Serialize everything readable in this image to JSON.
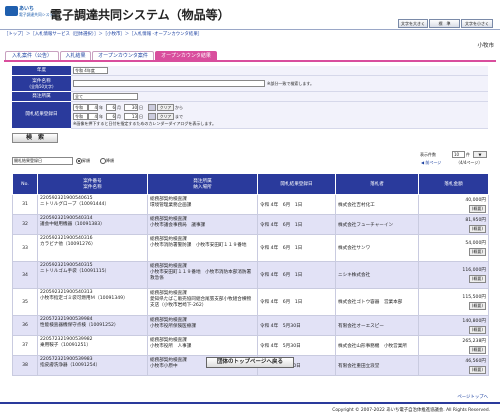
{
  "header": {
    "logo_top": "あいち",
    "logo_bottom": "電子調達共同システム",
    "title": "電子調達共同システム（物品等）",
    "btn_large": "文字を大きく",
    "btn_std": "標　準",
    "btn_small": "文字を小さく"
  },
  "breadcrumb": "［トップ］＞［入札情報サービス（団体選択）］＞［小牧市］＞［入札情報 -オープンカウンタ結果］",
  "org_name": "小牧市",
  "tabs": [
    "入札案件（公告）",
    "入札結果",
    "オープンカウンタ案件",
    "オープンカウンタ結果"
  ],
  "form": {
    "year_label": "年度",
    "year_value": "令和 4年度",
    "name_label": "案件名称",
    "name_sub": "(全角50文字)",
    "name_note": "※部分一致で検索します。",
    "dept_label": "発注所属",
    "dept_value": "全て",
    "date_label": "開札結果登録日",
    "era": "令和",
    "from_y": "4",
    "from_m": "6",
    "from_d": "30",
    "to_y": "4",
    "to_m": "6",
    "to_d": "13",
    "y_unit": "年",
    "m_unit": "月",
    "d_unit": "日",
    "clear": "クリア",
    "from_word": "から",
    "to_word": "まで",
    "cal_note": "※画像を押下すると日付を指定するためのカレンダーダイアログを表示します。"
  },
  "search_btn": "検　索",
  "sort": {
    "select_value": "開札結果登録日",
    "asc": "昇順",
    "desc": "降順"
  },
  "paging": {
    "per_page_label": "表示件数",
    "per_page_value": "10",
    "per_page_unit": "件",
    "prev": "前ページ",
    "page_info": "（4/4ページ）"
  },
  "table": {
    "headers": {
      "no": "No.",
      "case": "案件番号\n案件名称",
      "dept": "発注所属\n納入場所",
      "date": "開札結果登録日",
      "winner": "落札者",
      "amount": "落札金額"
    },
    "gaiyo_label": "(概要)",
    "rows": [
      {
        "no": "31",
        "case_no": "22059232190054061​5",
        "case_name": "ニトリルグローブ（10091444）",
        "dept": "総務部契約検査課",
        "place": "環境管理業務企画課",
        "date": "令和 4年　6月　1日",
        "winner": "株式会社吉村化工",
        "amount": "40,000円"
      },
      {
        "no": "32",
        "case_no": "2205923219005403​14",
        "case_name": "議会中継用機器（10091383）",
        "dept": "総務部契約検査課",
        "place": "小牧市議会事務局　議事課",
        "date": "令和 4年　6月　1日",
        "winner": "株式会社フューチャーイン",
        "amount": "81,950円"
      },
      {
        "no": "33",
        "case_no": "22059232190054031​6",
        "case_name": "カラビナ他（10091276）",
        "dept": "総務部契約検査課",
        "place": "小牧市消防署警防課　小牧市安田町１１９番地",
        "date": "令和 4年　6月　1日",
        "winner": "株式会社サンワ",
        "amount": "54,000円"
      },
      {
        "no": "34",
        "case_no": "22059232190054031​5",
        "case_name": "ニトリルゴム手袋（10091115）",
        "dept": "総務部契約検査課",
        "place": "小牧市安田町１１９番地　小牧市消防本部消防署救急係",
        "date": "令和 4年　6月　1日",
        "winner": "ニシキ株式会社",
        "amount": "116,000円"
      },
      {
        "no": "35",
        "case_no": "22059232190054031​3",
        "case_name": "小牧市指定ゴミ袋可燃用Ｍ（10091349）",
        "dept": "総務部契約検査課",
        "place": "愛知県たばこ販売協同組合尾張支部小牧組合横物支店（小牧市岩崎下-262）",
        "date": "令和 4年　6月　1日",
        "winner": "株式会社ゴトウ容器　営業本部",
        "amount": "115,500円"
      },
      {
        "no": "36",
        "case_no": "22057232190053998​4",
        "case_name": "性能検査器機保守点検（10091252）",
        "dept": "総務部契約検査課",
        "place": "小牧市役所保険医療課",
        "date": "令和 4年　5月30日",
        "winner": "有限会社オーエスピー",
        "amount": "140,800円"
      },
      {
        "no": "37",
        "case_no": "22057232190053998​2",
        "case_name": "乗用鞍子（10091251）",
        "dept": "総務部契約検査課",
        "place": "小牧市役所　人事課",
        "date": "令和 4年　5月30日",
        "winner": "株式会社山形事務機　小牧営業所",
        "amount": "265,238円"
      },
      {
        "no": "38",
        "case_no": "22057232190053998​3",
        "case_name": "指皮膚洗浄器（10091254）",
        "dept": "総務部契約検査課",
        "place": "小牧市小原中",
        "date": "令和 4年　5月30日",
        "winner": "有限会社重田立浪堂",
        "amount": "46,560円"
      }
    ]
  },
  "back_btn": "団体のトップページへ戻る",
  "pagetop": "ページトップへ",
  "copyright": "Copyright © 2007-2022 あいち電子自治体推進協議会. All Rights Reserved."
}
